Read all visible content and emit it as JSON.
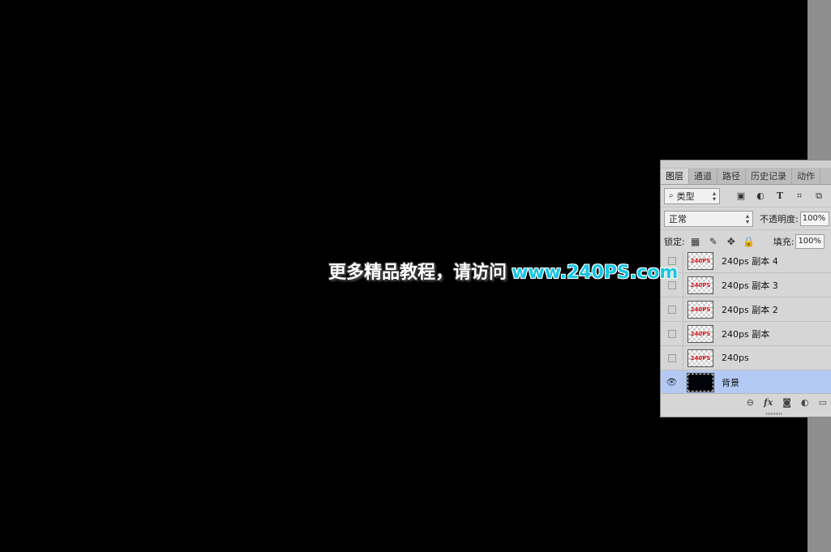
{
  "watermark": {
    "text_cn": "更多精品教程，请访问",
    "url": "www.240PS.com"
  },
  "panel": {
    "tabs": [
      "图层",
      "通道",
      "路径",
      "历史记录",
      "动作"
    ],
    "active_tab": "图层",
    "filter": {
      "label": "类型",
      "icons": [
        "image-icon",
        "adjustment-icon",
        "type-icon",
        "shape-icon",
        "smart-object-icon"
      ]
    },
    "blend": {
      "mode": "正常",
      "opacity_label": "不透明度:",
      "opacity_value": "100%"
    },
    "lock": {
      "label": "锁定:",
      "fill_label": "填充:",
      "fill_value": "100%"
    },
    "layers": [
      {
        "name": "240ps 副本 4",
        "thumb_text": "240PS",
        "visible": false,
        "selected": false
      },
      {
        "name": "240ps 副本 3",
        "thumb_text": "240PS",
        "visible": false,
        "selected": false
      },
      {
        "name": "240ps 副本 2",
        "thumb_text": "240PS",
        "visible": false,
        "selected": false
      },
      {
        "name": "240ps 副本",
        "thumb_text": "240PS",
        "visible": false,
        "selected": false
      },
      {
        "name": "240ps",
        "thumb_text": "240PS",
        "visible": false,
        "selected": false
      },
      {
        "name": "背景",
        "thumb_text": "",
        "visible": true,
        "selected": true
      }
    ],
    "bottom_icons": [
      "link-icon",
      "fx-icon",
      "mask-icon",
      "adjustment-layer-icon",
      "folder-icon"
    ]
  },
  "colors": {
    "canvas": "#000000",
    "url": "#16c6e6",
    "selected_layer": "#b3cbf4",
    "thumb_text": "#d8141b"
  }
}
